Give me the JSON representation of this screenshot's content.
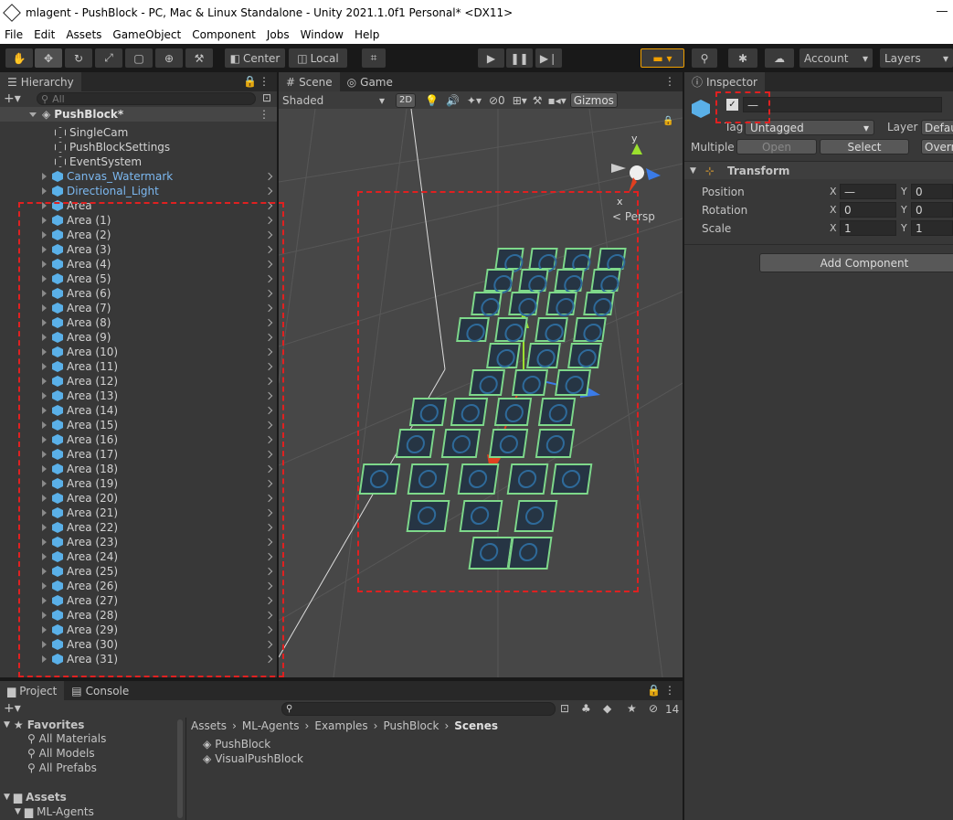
{
  "window": {
    "title": "mlagent - PushBlock - PC, Mac & Linux Standalone - Unity 2021.1.0f1 Personal* <DX11>"
  },
  "menu": [
    "File",
    "Edit",
    "Assets",
    "GameObject",
    "Component",
    "Jobs",
    "Window",
    "Help"
  ],
  "toolbar": {
    "center": "Center",
    "local": "Local",
    "account": "Account",
    "layers": "Layers"
  },
  "hierarchy": {
    "tab": "Hierarchy",
    "search_placeholder": "All",
    "scene": "PushBlock*",
    "items": [
      {
        "label": "SingleCam",
        "kind": "object"
      },
      {
        "label": "PushBlockSettings",
        "kind": "object"
      },
      {
        "label": "EventSystem",
        "kind": "object"
      },
      {
        "label": "Canvas_Watermark",
        "kind": "prefab-blue"
      },
      {
        "label": "Directional_Light",
        "kind": "prefab-blue"
      },
      {
        "label": "Area",
        "kind": "prefab"
      },
      {
        "label": "Area (1)",
        "kind": "prefab"
      },
      {
        "label": "Area (2)",
        "kind": "prefab"
      },
      {
        "label": "Area (3)",
        "kind": "prefab"
      },
      {
        "label": "Area (4)",
        "kind": "prefab"
      },
      {
        "label": "Area (5)",
        "kind": "prefab"
      },
      {
        "label": "Area (6)",
        "kind": "prefab"
      },
      {
        "label": "Area (7)",
        "kind": "prefab"
      },
      {
        "label": "Area (8)",
        "kind": "prefab"
      },
      {
        "label": "Area (9)",
        "kind": "prefab"
      },
      {
        "label": "Area (10)",
        "kind": "prefab"
      },
      {
        "label": "Area (11)",
        "kind": "prefab"
      },
      {
        "label": "Area (12)",
        "kind": "prefab"
      },
      {
        "label": "Area (13)",
        "kind": "prefab"
      },
      {
        "label": "Area (14)",
        "kind": "prefab"
      },
      {
        "label": "Area (15)",
        "kind": "prefab"
      },
      {
        "label": "Area (16)",
        "kind": "prefab"
      },
      {
        "label": "Area (17)",
        "kind": "prefab"
      },
      {
        "label": "Area (18)",
        "kind": "prefab"
      },
      {
        "label": "Area (19)",
        "kind": "prefab"
      },
      {
        "label": "Area (20)",
        "kind": "prefab"
      },
      {
        "label": "Area (21)",
        "kind": "prefab"
      },
      {
        "label": "Area (22)",
        "kind": "prefab"
      },
      {
        "label": "Area (23)",
        "kind": "prefab"
      },
      {
        "label": "Area (24)",
        "kind": "prefab"
      },
      {
        "label": "Area (25)",
        "kind": "prefab"
      },
      {
        "label": "Area (26)",
        "kind": "prefab"
      },
      {
        "label": "Area (27)",
        "kind": "prefab"
      },
      {
        "label": "Area (28)",
        "kind": "prefab"
      },
      {
        "label": "Area (29)",
        "kind": "prefab"
      },
      {
        "label": "Area (30)",
        "kind": "prefab"
      },
      {
        "label": "Area (31)",
        "kind": "prefab"
      }
    ]
  },
  "scene": {
    "tab_scene": "Scene",
    "tab_game": "Game",
    "shading": "Shaded",
    "mode2d": "2D",
    "hidden_count": "0",
    "gizmos": "Gizmos",
    "persp": "< Persp",
    "axis_y": "y",
    "axis_x": "x"
  },
  "inspector": {
    "tab": "Inspector",
    "name_value": "—",
    "tag_label": "Tag",
    "tag_value": "Untagged",
    "layer_label": "Layer",
    "layer_value": "Defau",
    "multiple": "Multiple",
    "open": "Open",
    "select": "Select",
    "overrides": "Overr",
    "transform": "Transform",
    "position": {
      "label": "Position",
      "x": "—",
      "y": "0"
    },
    "rotation": {
      "label": "Rotation",
      "x": "0",
      "y": "0"
    },
    "scale": {
      "label": "Scale",
      "x": "1",
      "y": "1"
    },
    "axis_x": "X",
    "axis_y": "Y",
    "add_component": "Add Component"
  },
  "project": {
    "tab_project": "Project",
    "tab_console": "Console",
    "hidden_count": "14",
    "favorites": "Favorites",
    "fav_items": [
      "All Materials",
      "All Models",
      "All Prefabs"
    ],
    "assets": "Assets",
    "assets_child": "ML-Agents",
    "breadcrumb": [
      "Assets",
      "ML-Agents",
      "Examples",
      "PushBlock",
      "Scenes"
    ],
    "files": [
      "PushBlock",
      "VisualPushBlock"
    ]
  }
}
